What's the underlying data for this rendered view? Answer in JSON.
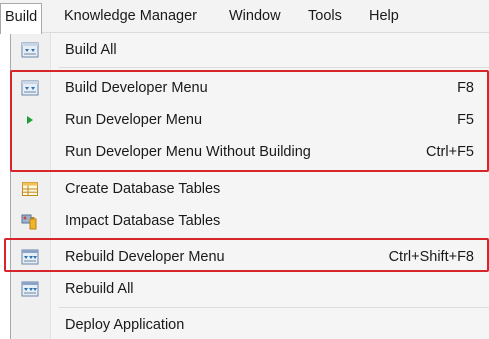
{
  "menubar": {
    "items": [
      {
        "label": "Build"
      },
      {
        "label": "Knowledge Manager"
      },
      {
        "label": "Window"
      },
      {
        "label": "Tools"
      },
      {
        "label": "Help"
      }
    ]
  },
  "build_menu": {
    "items": [
      {
        "label": "Build All",
        "shortcut": "",
        "icon": "build-icon"
      },
      {
        "label": "Build Developer Menu",
        "shortcut": "F8",
        "icon": "build-icon"
      },
      {
        "label": "Run Developer Menu",
        "shortcut": "F5",
        "icon": "run-arrow-icon"
      },
      {
        "label": "Run Developer Menu Without Building",
        "shortcut": "Ctrl+F5",
        "icon": ""
      },
      {
        "label": "Create Database Tables",
        "shortcut": "",
        "icon": "table-icon"
      },
      {
        "label": "Impact Database Tables",
        "shortcut": "",
        "icon": "impact-icon"
      },
      {
        "label": "Rebuild Developer Menu",
        "shortcut": "Ctrl+Shift+F8",
        "icon": "rebuild-icon"
      },
      {
        "label": "Rebuild All",
        "shortcut": "",
        "icon": "rebuild-icon"
      },
      {
        "label": "Deploy Application",
        "shortcut": "",
        "icon": ""
      }
    ]
  },
  "colors": {
    "highlight_border": "#d6262c",
    "run_arrow": "#1e9e3a"
  }
}
